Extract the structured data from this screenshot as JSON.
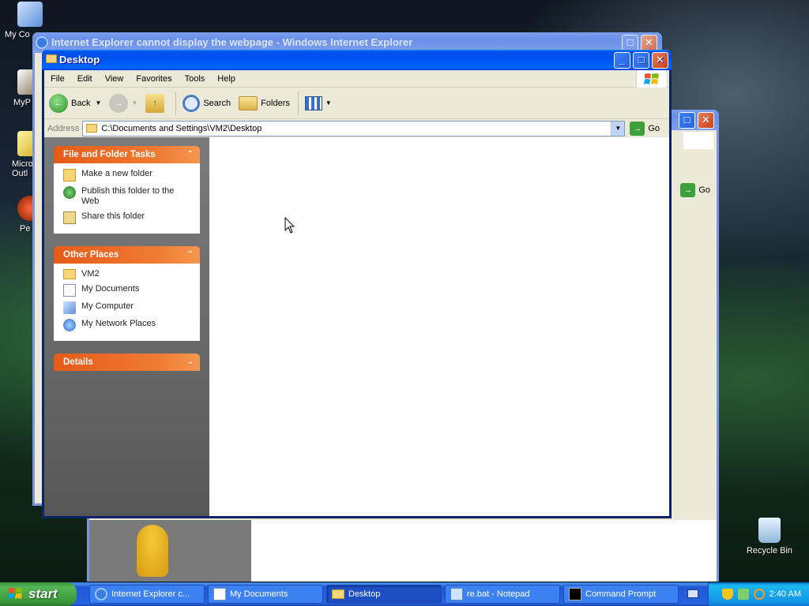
{
  "desktop": {
    "icons": [
      {
        "label": "My Co"
      },
      {
        "label": "MyP"
      },
      {
        "label": "Micro Outl"
      },
      {
        "label": "Pe"
      }
    ],
    "recycle_bin": "Recycle Bin"
  },
  "ie_window": {
    "title": "Internet Explorer cannot display the webpage - Windows Internet Explorer"
  },
  "mydocs_window": {
    "go_label": "Go"
  },
  "explorer": {
    "title": "Desktop",
    "menu": [
      "File",
      "Edit",
      "View",
      "Favorites",
      "Tools",
      "Help"
    ],
    "toolbar": {
      "back": "Back",
      "search": "Search",
      "folders": "Folders"
    },
    "address": {
      "label": "Address",
      "value": "C:\\Documents and Settings\\VM2\\Desktop",
      "go": "Go"
    },
    "panels": {
      "tasks": {
        "title": "File and Folder Tasks",
        "items": [
          "Make a new folder",
          "Publish this folder to the Web",
          "Share this folder"
        ]
      },
      "places": {
        "title": "Other Places",
        "items": [
          "VM2",
          "My Documents",
          "My Computer",
          "My Network Places"
        ]
      },
      "details": {
        "title": "Details"
      }
    }
  },
  "taskbar": {
    "start": "start",
    "buttons": [
      "Internet Explorer c...",
      "My Documents",
      "Desktop",
      "re.bat - Notepad",
      "Command Prompt"
    ],
    "clock": "2:40 AM"
  },
  "colors": {
    "titlebar": "#0053ee",
    "panel_header": "#e55a18",
    "taskpane": "#6e6e6e",
    "taskbar": "#2663e0",
    "start_button": "#3a9a3a"
  }
}
